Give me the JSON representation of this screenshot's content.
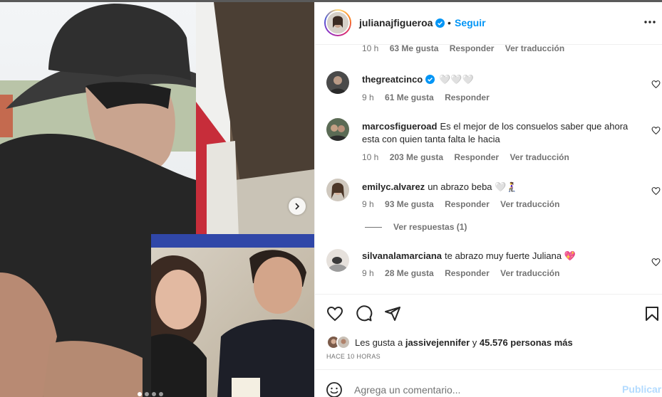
{
  "header": {
    "username": "julianajfigueroa",
    "separator": "•",
    "follow_label": "Seguir"
  },
  "top_meta": {
    "time": "10 h",
    "likes": "63 Me gusta",
    "reply": "Responder",
    "translate": "Ver traducción"
  },
  "comments": [
    {
      "username": "thegreatcinco",
      "text": "🤍🤍🤍",
      "time": "9 h",
      "likes": "61 Me gusta",
      "reply": "Responder",
      "translate": ""
    },
    {
      "username": "marcosfigueroad",
      "text": "Es el mejor de los consuelos saber que ahora esta con quien tanta falta le hacia",
      "time": "10 h",
      "likes": "203 Me gusta",
      "reply": "Responder",
      "translate": "Ver traducción"
    },
    {
      "username": "emilyc.alvarez",
      "text": "un abrazo beba 🤍🧎‍♀️",
      "time": "9 h",
      "likes": "93 Me gusta",
      "reply": "Responder",
      "translate": "Ver traducción"
    },
    {
      "username": "silvanalamarciana",
      "text": "te abrazo muy fuerte Juliana 💖",
      "time": "9 h",
      "likes": "28 Me gusta",
      "reply": "Responder",
      "translate": "Ver traducción"
    }
  ],
  "view_replies": "Ver respuestas (1)",
  "likes": {
    "prefix": "Les gusta a",
    "user": "jassivejennifer",
    "middle": "y",
    "count": "45.576 personas más"
  },
  "time_ago": "HACE 10 HORAS",
  "comment_input": {
    "placeholder": "Agrega un comentario...",
    "value": ""
  },
  "publish_label": "Publicar",
  "carousel": {
    "slides": 4,
    "active": 0
  },
  "icons": {
    "verified": "verified-badge-icon",
    "more": "more-options-icon",
    "like": "heart-icon",
    "comment": "comment-icon",
    "share": "share-icon",
    "save": "bookmark-icon",
    "emoji": "emoji-icon",
    "next": "chevron-right-icon"
  },
  "colors": {
    "accent": "#0095f6",
    "verified": "#0095f6",
    "muted": "#737373",
    "publish_disabled": "#b3dbff"
  }
}
